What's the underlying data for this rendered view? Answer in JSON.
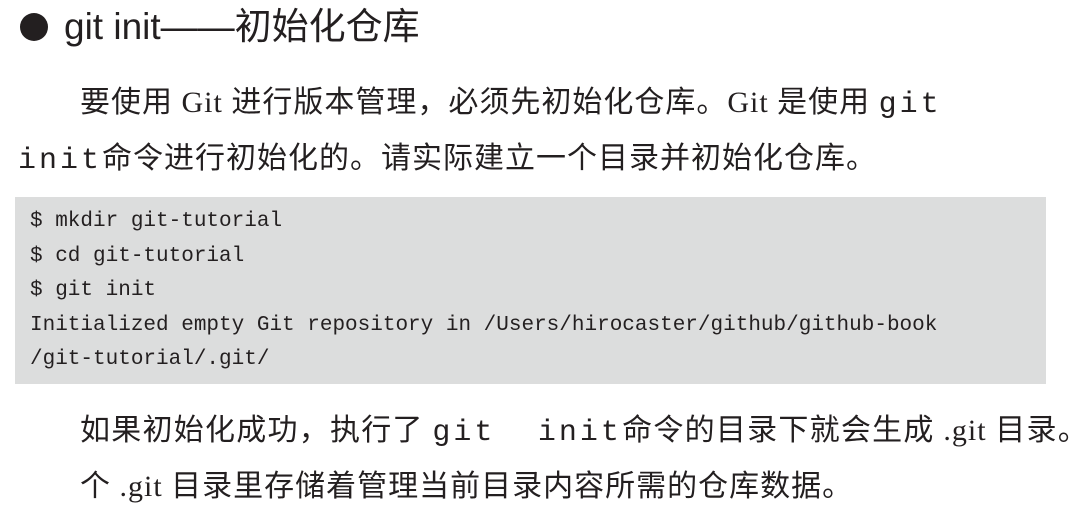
{
  "heading": {
    "text": "git init——初始化仓库"
  },
  "para1": {
    "seg1": "要使用 Git 进行版本管理，必须先初始化仓库。Git 是使用 ",
    "cmd1": "git",
    "cmd2": "init",
    "seg2": "命令进行初始化的。请实际建立一个目录并初始化仓库。"
  },
  "code": {
    "lines": [
      "$ mkdir git-tutorial",
      "$ cd git-tutorial",
      "$ git init",
      "Initialized empty Git repository in /Users/hirocaster/github/github-book",
      "/git-tutorial/.git/"
    ]
  },
  "para2": {
    "seg1": "如果初始化成功，执行了 ",
    "cmd": "git  init",
    "seg2": "命令的目录下就会生成 .git 目录。这个 .git 目录里存储着管理当前目录内容所需的仓库数据。"
  }
}
